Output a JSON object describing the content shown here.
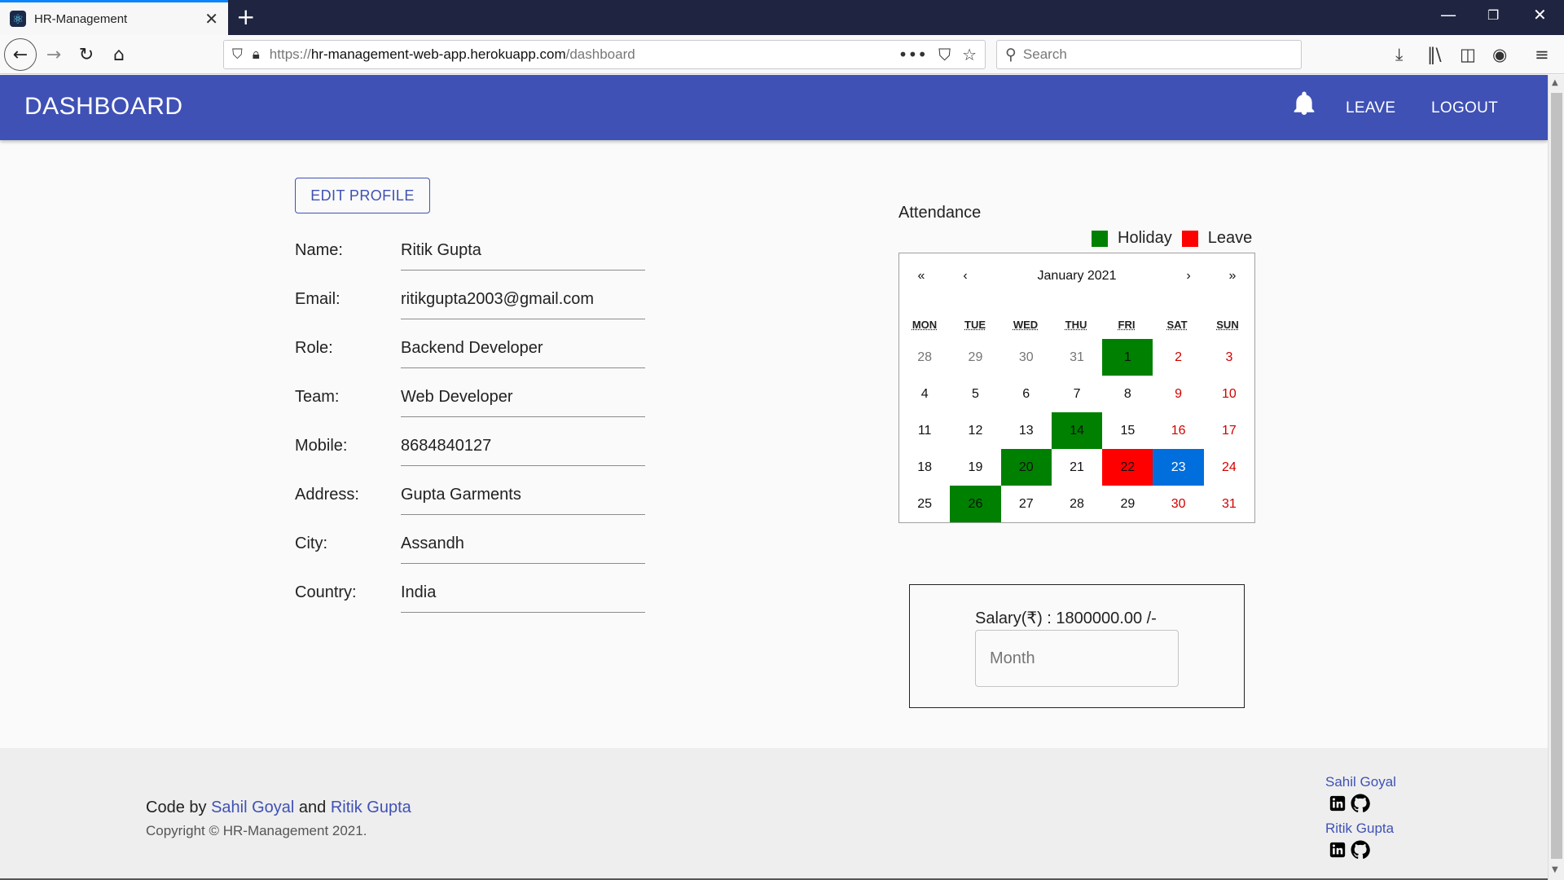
{
  "browser": {
    "tab_title": "HR-Management",
    "url_proto": "https://",
    "url_host": "hr-management-web-app.herokuapp.com",
    "url_path": "/dashboard",
    "search_placeholder": "Search"
  },
  "header": {
    "title": "DASHBOARD",
    "nav": {
      "leave": "LEAVE",
      "logout": "LOGOUT"
    }
  },
  "profile": {
    "edit_label": "EDIT PROFILE",
    "fields": [
      {
        "label": "Name:",
        "value": "Ritik Gupta"
      },
      {
        "label": "Email:",
        "value": "ritikgupta2003@gmail.com"
      },
      {
        "label": "Role:",
        "value": "Backend Developer"
      },
      {
        "label": "Team:",
        "value": "Web Developer"
      },
      {
        "label": "Mobile:",
        "value": "8684840127"
      },
      {
        "label": "Address:",
        "value": "Gupta Garments"
      },
      {
        "label": "City:",
        "value": "Assandh"
      },
      {
        "label": "Country:",
        "value": "India"
      }
    ]
  },
  "attendance": {
    "title": "Attendance",
    "legend": {
      "holiday": "Holiday",
      "leave": "Leave"
    },
    "colors": {
      "holiday": "#008000",
      "leave": "#ff0000",
      "today": "#006edc",
      "weekend": "#d10000"
    },
    "calendar": {
      "nav": {
        "prev_year": "«",
        "prev_month": "‹",
        "label": "January 2021",
        "next_month": "›",
        "next_year": "»"
      },
      "weekdays": [
        "MON",
        "TUE",
        "WED",
        "THU",
        "FRI",
        "SAT",
        "SUN"
      ],
      "days": [
        {
          "d": "28",
          "state": "muted"
        },
        {
          "d": "29",
          "state": "muted"
        },
        {
          "d": "30",
          "state": "muted"
        },
        {
          "d": "31",
          "state": "muted"
        },
        {
          "d": "1",
          "state": "holiday"
        },
        {
          "d": "2",
          "state": "weekend"
        },
        {
          "d": "3",
          "state": "weekend"
        },
        {
          "d": "4",
          "state": ""
        },
        {
          "d": "5",
          "state": ""
        },
        {
          "d": "6",
          "state": ""
        },
        {
          "d": "7",
          "state": ""
        },
        {
          "d": "8",
          "state": ""
        },
        {
          "d": "9",
          "state": "weekend"
        },
        {
          "d": "10",
          "state": "weekend"
        },
        {
          "d": "11",
          "state": ""
        },
        {
          "d": "12",
          "state": ""
        },
        {
          "d": "13",
          "state": ""
        },
        {
          "d": "14",
          "state": "holiday"
        },
        {
          "d": "15",
          "state": ""
        },
        {
          "d": "16",
          "state": "weekend"
        },
        {
          "d": "17",
          "state": "weekend"
        },
        {
          "d": "18",
          "state": ""
        },
        {
          "d": "19",
          "state": ""
        },
        {
          "d": "20",
          "state": "holiday"
        },
        {
          "d": "21",
          "state": ""
        },
        {
          "d": "22",
          "state": "leave"
        },
        {
          "d": "23",
          "state": "today"
        },
        {
          "d": "24",
          "state": "weekend"
        },
        {
          "d": "25",
          "state": ""
        },
        {
          "d": "26",
          "state": "holiday"
        },
        {
          "d": "27",
          "state": ""
        },
        {
          "d": "28",
          "state": ""
        },
        {
          "d": "29",
          "state": ""
        },
        {
          "d": "30",
          "state": "weekend"
        },
        {
          "d": "31",
          "state": "weekend"
        }
      ]
    }
  },
  "salary": {
    "text": "Salary(₹) : 1800000.00 /-",
    "month_placeholder": "Month"
  },
  "footer": {
    "code_by": "Code by",
    "and": "and",
    "author1": "Sahil Goyal",
    "author2": "Ritik Gupta",
    "copyright": "Copyright © HR-Management 2021."
  }
}
